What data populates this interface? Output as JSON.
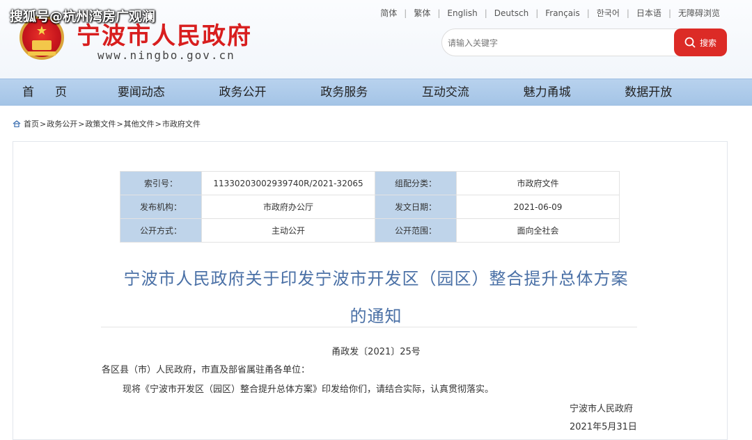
{
  "watermark": "搜狐号@杭州湾房广观澜",
  "header": {
    "site_title": "宁波市人民政府",
    "site_domain": "www.ningbo.gov.cn"
  },
  "lang_links": [
    "简体",
    "繁体",
    "English",
    "Deutsch",
    "Français",
    "한국어",
    "日本语",
    "无障碍浏览"
  ],
  "search": {
    "placeholder": "请输入关键字",
    "button_label": "搜索"
  },
  "nav": [
    "首页",
    "要闻动态",
    "政务公开",
    "政务服务",
    "互动交流",
    "魅力甬城",
    "数据开放"
  ],
  "breadcrumb": [
    "首页",
    "政务公开",
    "政策文件",
    "其他文件",
    "市政府文件"
  ],
  "meta": {
    "rows": [
      {
        "k1": "索引号：",
        "v1": "11330203002939740R/2021-32065",
        "k2": "组配分类：",
        "v2": "市政府文件"
      },
      {
        "k1": "发布机构：",
        "v1": "市政府办公厅",
        "k2": "发文日期：",
        "v2": "2021-06-09"
      },
      {
        "k1": "公开方式：",
        "v1": "主动公开",
        "k2": "公开范围：",
        "v2": "面向全社会"
      }
    ]
  },
  "document": {
    "title_line1": "宁波市人民政府关于印发宁波市开发区（园区）整合提升总体方案",
    "title_line2": "的通知",
    "number": "甬政发〔2021〕25号",
    "recipient": "各区县（市）人民政府，市直及部省属驻甬各单位：",
    "body": "现将《宁波市开发区（园区）整合提升总体方案》印发给你们，请结合实际，认真贯彻落实。",
    "issuer": "宁波市人民政府",
    "date": "2021年5月31日"
  }
}
